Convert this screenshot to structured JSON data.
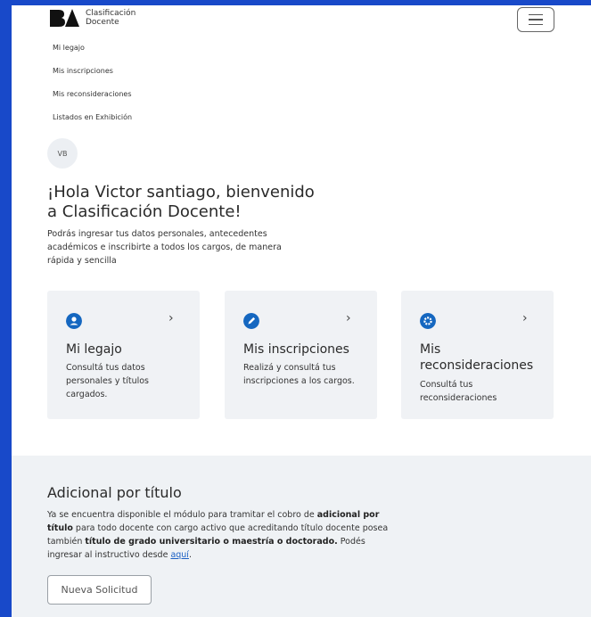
{
  "brand": {
    "mark": "BA",
    "line1": "Clasificación",
    "line2": "Docente"
  },
  "nav": {
    "items": [
      {
        "label": "Mi legajo"
      },
      {
        "label": "Mis inscripciones"
      },
      {
        "label": "Mis reconsideraciones"
      },
      {
        "label": "Listados en Exhibición"
      }
    ]
  },
  "user": {
    "initials": "VB"
  },
  "greeting": {
    "title": "¡Hola Victor santiago, bienvenido a Clasificación Docente!",
    "intro": "Podrás ingresar tus datos personales, antecedentes académicos e inscribirte a todos los cargos, de manera rápida y sencilla"
  },
  "cards": [
    {
      "icon": "user-icon",
      "title": "Mi legajo",
      "description": "Consultá tus datos personales y títulos cargados.",
      "arrow": "›"
    },
    {
      "icon": "pencil-icon",
      "title": "Mis inscripciones",
      "description": "Realizá y consultá tus inscripciones a los cargos.",
      "arrow": "›"
    },
    {
      "icon": "gear-icon",
      "title": "Mis reconsideraciones",
      "description": "Consultá tus reconsideraciones",
      "arrow": "›"
    }
  ],
  "banner": {
    "title": "Adicional por título",
    "text": {
      "p1": "Ya se encuentra disponible el módulo para tramitar el cobro de ",
      "b1": "adicional por título",
      "p2": " para todo docente con cargo activo que acreditando título docente posea también ",
      "b2": "título de grado universitario o maestría o doctorado.",
      "p3": " Podés ingresar al instructivo desde ",
      "link": "aquí",
      "p4": "."
    },
    "button": "Nueva Solicitud"
  },
  "colors": {
    "accent": "#1567c0",
    "frame": "#1849c9",
    "card_bg": "#f0f2f5"
  }
}
